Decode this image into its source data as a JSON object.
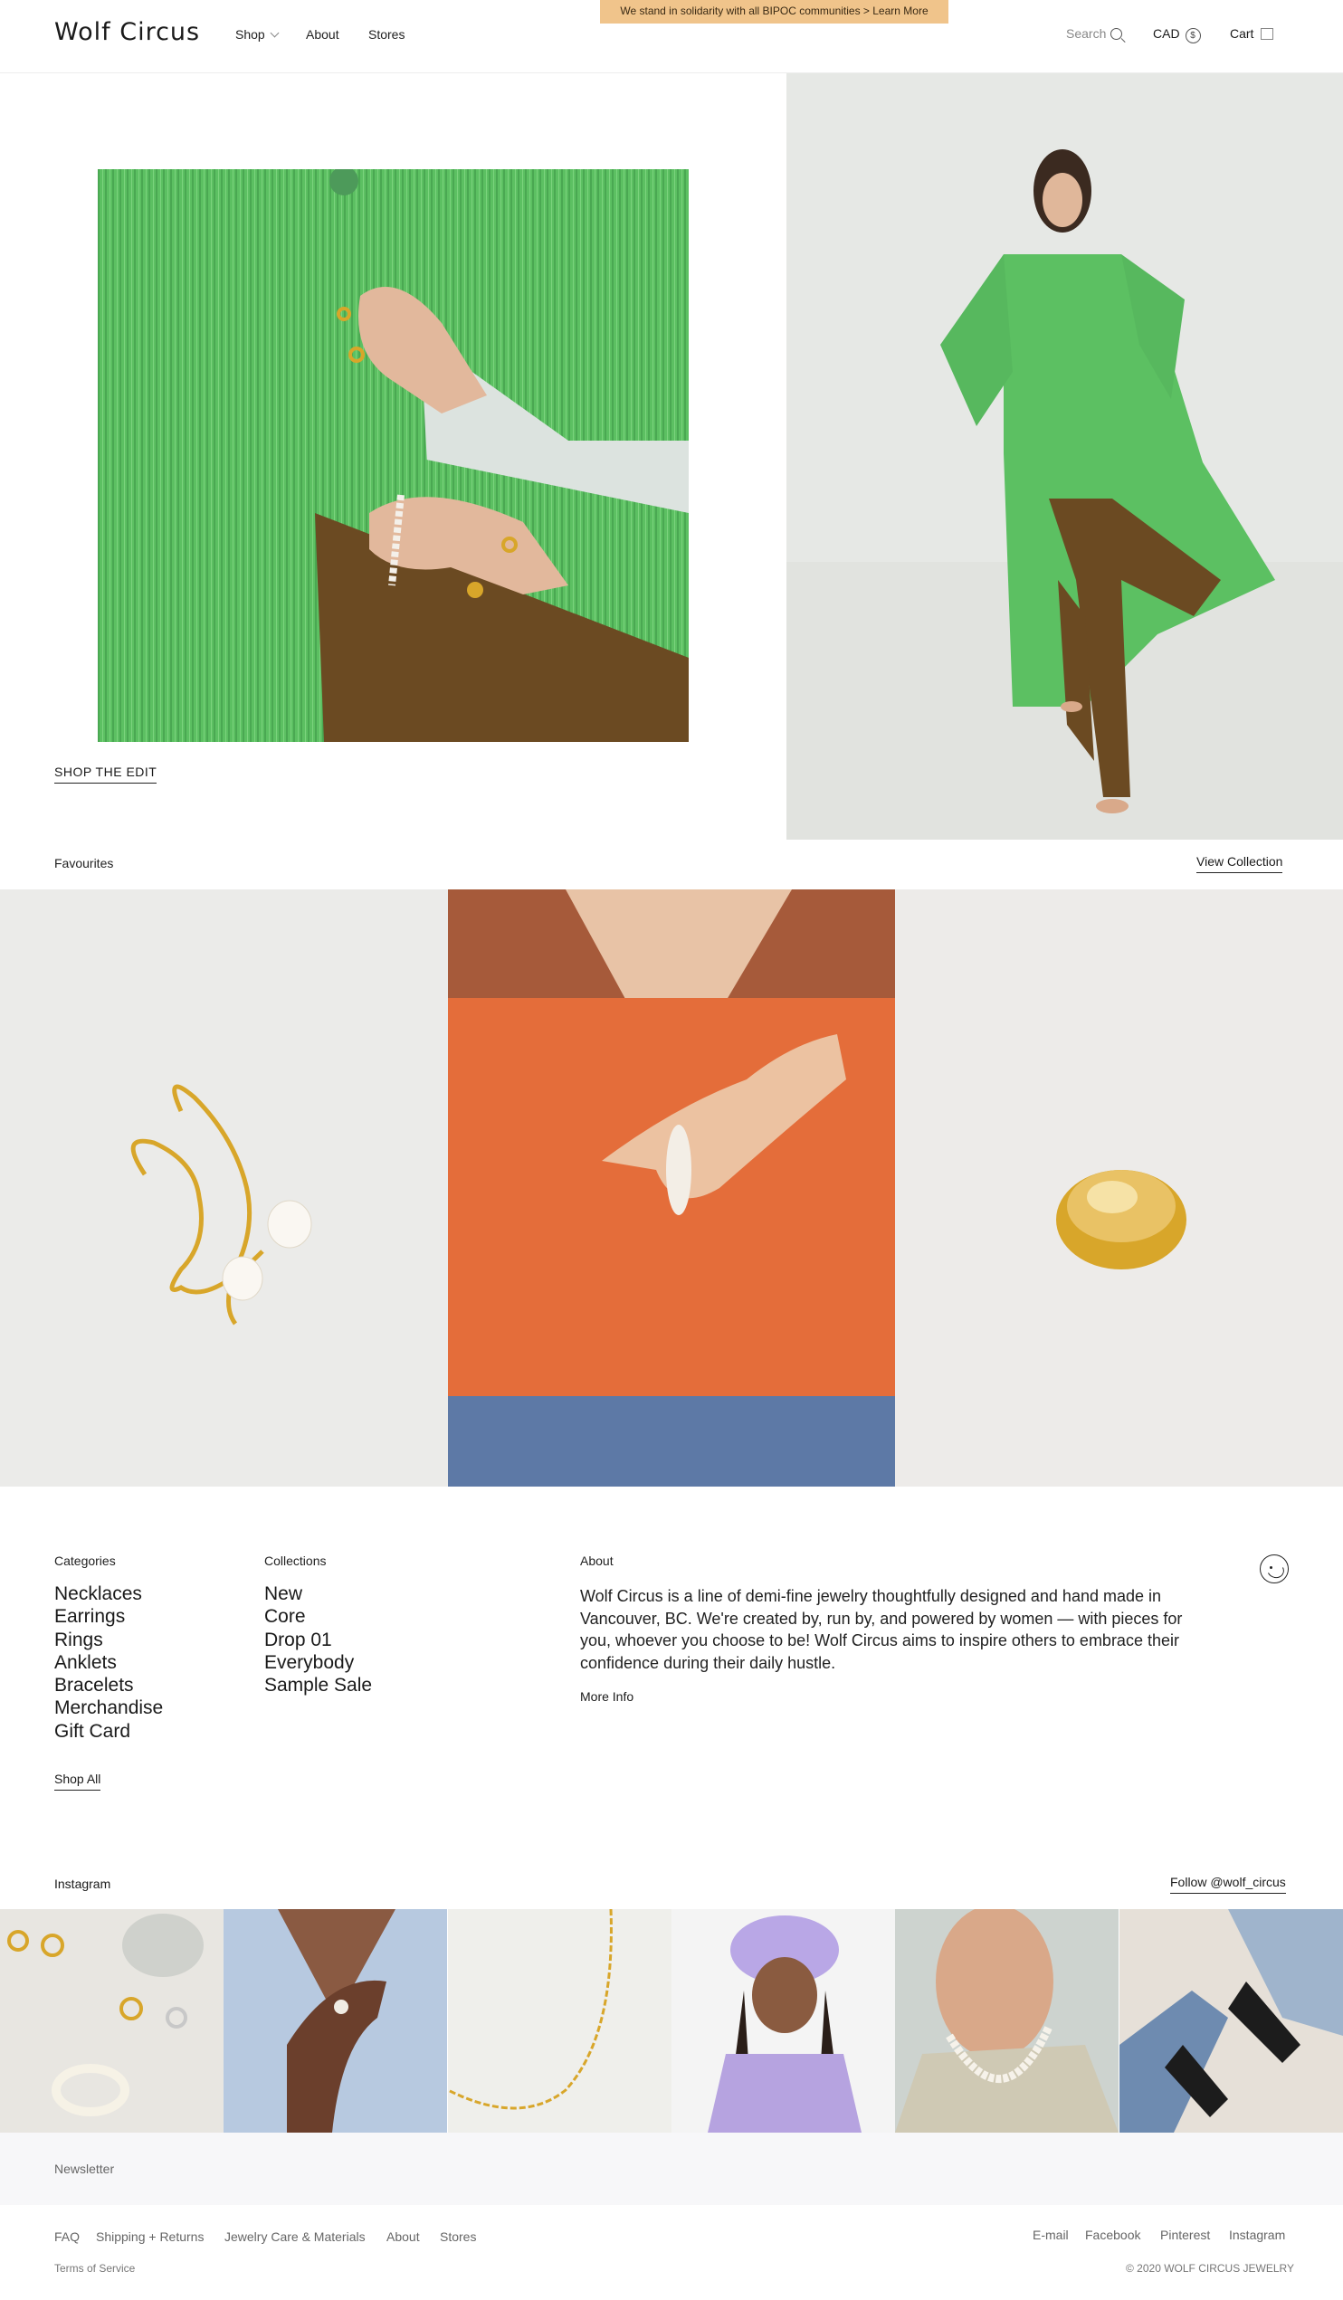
{
  "announcement": "We stand in solidarity with all BIPOC communities > Learn More",
  "header": {
    "logo": "Wolf Circus",
    "nav": [
      "Shop",
      "About",
      "Stores"
    ],
    "search_label": "Search",
    "currency": "CAD",
    "currency_symbol": "$",
    "cart_label": "Cart"
  },
  "hero": {
    "cta": "SHOP THE EDIT"
  },
  "favourites": {
    "title": "Favourites",
    "view_collection": "View Collection"
  },
  "footer_info": {
    "categories_head": "Categories",
    "categories": [
      "Necklaces",
      "Earrings",
      "Rings",
      "Anklets",
      "Bracelets",
      "Merchandise",
      "Gift Card"
    ],
    "shop_all": "Shop All",
    "collections_head": "Collections",
    "collections": [
      "New",
      "Core",
      "Drop 01",
      "Everybody",
      "Sample Sale"
    ],
    "about_head": "About",
    "about_text": "Wolf Circus is a line of demi-fine jewelry thoughtfully designed and hand made in Vancouver, BC. We're created by, run by, and powered by women — with pieces for you, whoever you choose to be! Wolf Circus aims to inspire others to embrace their confidence during their daily hustle.",
    "more_info": "More Info"
  },
  "instagram": {
    "title": "Instagram",
    "follow": "Follow @wolf_circus"
  },
  "newsletter": "Newsletter",
  "footer": {
    "links": [
      "FAQ",
      "Shipping + Returns",
      "Jewelry Care & Materials",
      "About",
      "Stores"
    ],
    "social": [
      "E-mail",
      "Facebook",
      "Pinterest",
      "Instagram"
    ],
    "terms": "Terms of Service",
    "copyright": "© 2020 WOLF CIRCUS JEWELRY"
  },
  "colors": {
    "announcement_bg": "#f0c48b",
    "coat_green": "#5cc062",
    "shirt_orange": "#d96a3a",
    "gold": "#d8a62a"
  }
}
